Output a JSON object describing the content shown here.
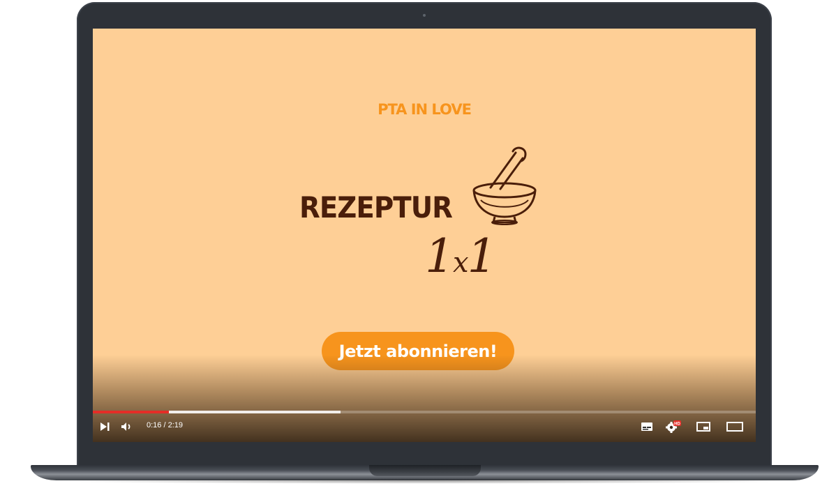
{
  "video": {
    "brand": "PTA IN LOVE",
    "title_word": "REZEPTUR",
    "title_number_1": "1",
    "title_number_x": "x",
    "title_number_2": "1",
    "subscribe_label": "Jetzt abonnieren!"
  },
  "player": {
    "current_time": "0:16",
    "duration": "2:19",
    "time_display": "0:16 / 2:19",
    "progress_played_fraction": 0.115,
    "progress_buffered_fraction": 0.374,
    "quality_badge": "HD"
  },
  "colors": {
    "screen_background": "#fecf96",
    "accent_orange": "#f7941d",
    "title_brown": "#4a1e0a",
    "progress_red": "#e52d27"
  },
  "icons": {
    "mortar": "mortar-and-pestle-icon",
    "next": "next-icon",
    "volume": "volume-icon",
    "subtitles": "subtitles-icon",
    "settings": "settings-icon",
    "miniplayer": "miniplayer-icon",
    "theater": "theater-mode-icon"
  }
}
